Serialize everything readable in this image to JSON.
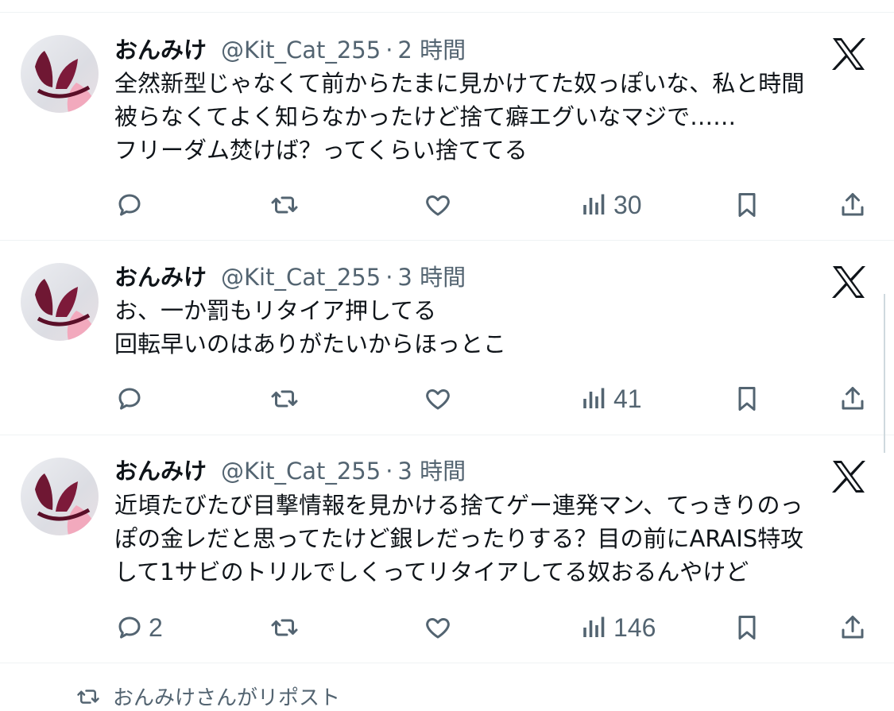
{
  "tweets": [
    {
      "name": "おんみけ",
      "handle": "@Kit_Cat_255",
      "separator": "·",
      "time": "2 時間",
      "lines": [
        "全然新型じゃなくて前からたまに見かけてた奴っぽいな、私と時間",
        "被らなくてよく知らなかったけど捨て癖エグいなマジで……",
        "フリーダム焚けば？ってくらい捨ててる"
      ],
      "replies": "",
      "views": "30"
    },
    {
      "name": "おんみけ",
      "handle": "@Kit_Cat_255",
      "separator": "·",
      "time": "3 時間",
      "lines": [
        "お、一か罰もリタイア押してる",
        "回転早いのはありがたいからほっとこ"
      ],
      "replies": "",
      "views": "41"
    },
    {
      "name": "おんみけ",
      "handle": "@Kit_Cat_255",
      "separator": "·",
      "time": "3 時間",
      "lines": [
        "近頃たびたび目撃情報を見かける捨てゲー連発マン、てっきりのっ",
        "ぽの金レだと思ってたけど銀レだったりする？目の前にARAIS特攻",
        "して1サビのトリルでしくってリタイアしてる奴おるんやけど"
      ],
      "replies": "2",
      "views": "146"
    }
  ],
  "repost_note": "おんみけさんがリポスト",
  "icons": [
    "reply-icon",
    "retweet-icon",
    "like-icon",
    "views-icon",
    "bookmark-icon",
    "share-icon",
    "x-logo-icon"
  ],
  "colors": {
    "text": "#0f1419",
    "muted": "#536471",
    "divider": "#eff3f4"
  }
}
